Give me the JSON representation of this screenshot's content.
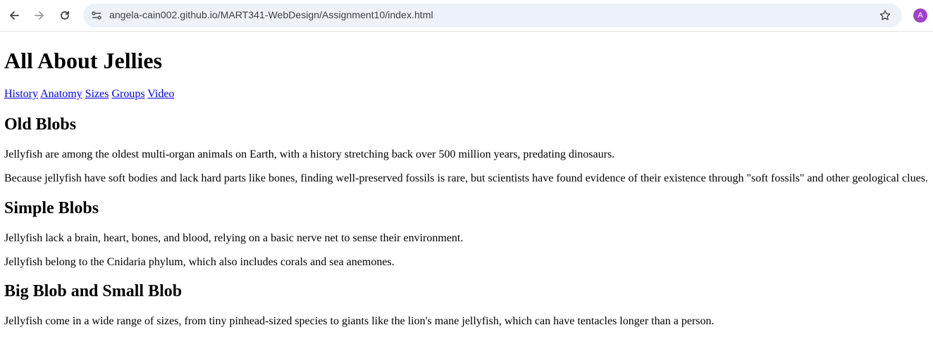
{
  "browser": {
    "url": "angela-cain002.github.io/MART341-WebDesign/Assignment10/index.html",
    "profile_initial": "A",
    "profile_color": "#a142c8",
    "icons": [
      "arrow-back-icon",
      "arrow-forward-icon",
      "reload-icon",
      "site-info-icon",
      "bookmark-star-icon"
    ]
  },
  "page": {
    "title": "All About Jellies",
    "nav_links": [
      "History",
      "Anatomy",
      "Sizes",
      "Groups",
      "Video"
    ],
    "sections": [
      {
        "heading": "Old Blobs",
        "paragraphs": [
          "Jellyfish are among the oldest multi-organ animals on Earth, with a history stretching back over 500 million years, predating dinosaurs.",
          "Because jellyfish have soft bodies and lack hard parts like bones, finding well-preserved fossils is rare, but scientists have found evidence of their existence through \"soft fossils\" and other geological clues."
        ]
      },
      {
        "heading": "Simple Blobs",
        "paragraphs": [
          "Jellyfish lack a brain, heart, bones, and blood, relying on a basic nerve net to sense their environment.",
          "Jellyfish belong to the Cnidaria phylum, which also includes corals and sea anemones."
        ]
      },
      {
        "heading": "Big Blob and Small Blob",
        "paragraphs": [
          "Jellyfish come in a wide range of sizes, from tiny pinhead-sized species to giants like the lion's mane jellyfish, which can have tentacles longer than a person."
        ]
      }
    ]
  }
}
